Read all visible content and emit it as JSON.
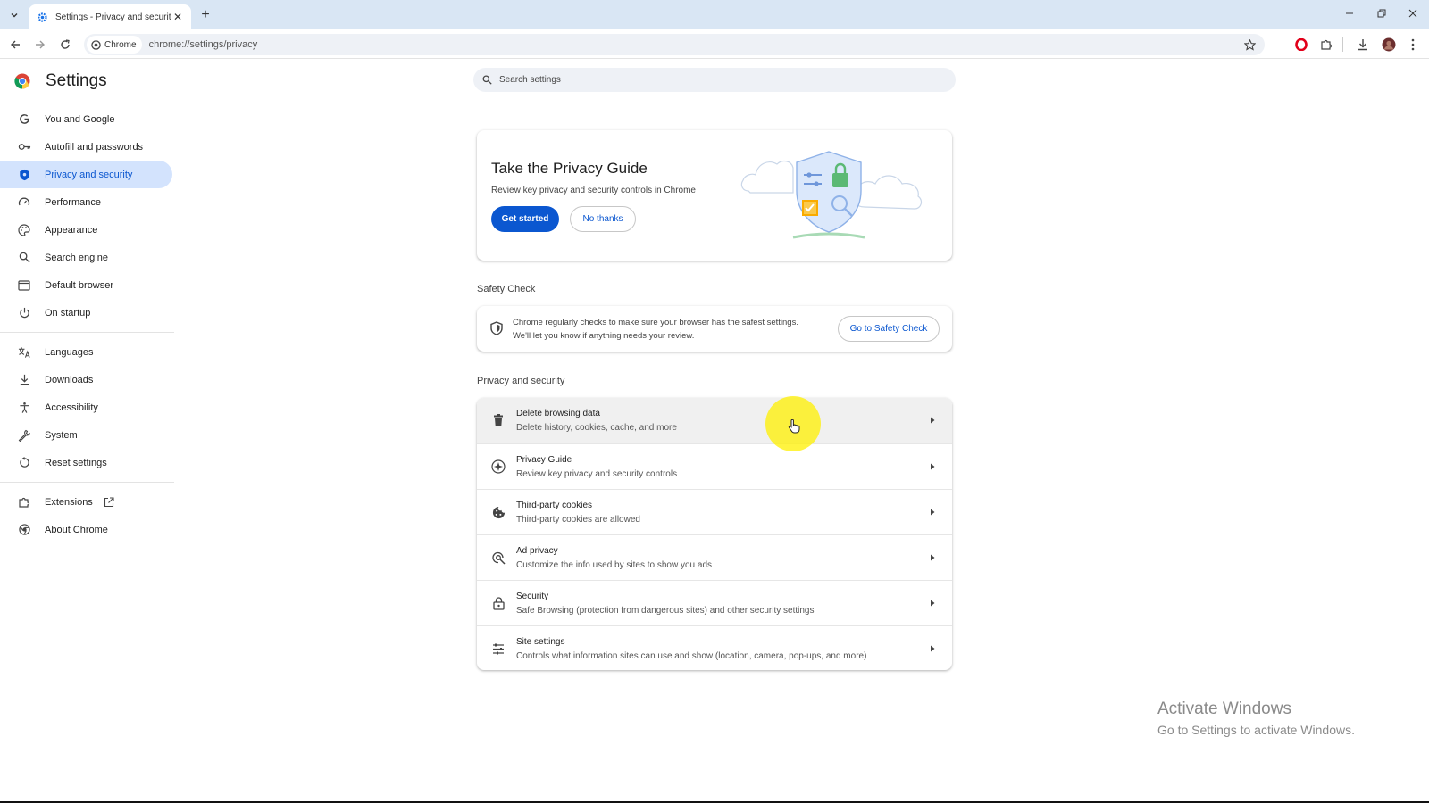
{
  "browser": {
    "tab": {
      "title": "Settings - Privacy and security",
      "close_icon": "close-icon",
      "favicon": "gear-icon"
    },
    "new_tab_icon": "plus-icon",
    "omnibox": {
      "chip_label": "Chrome",
      "url": "chrome://settings/privacy"
    },
    "window_controls": [
      "minimize-icon",
      "restore-icon",
      "close-icon"
    ]
  },
  "sidebar": {
    "title": "Settings",
    "items": [
      {
        "label": "You and Google",
        "icon": "google-g-icon",
        "active": false
      },
      {
        "label": "Autofill and passwords",
        "icon": "key-icon",
        "active": false
      },
      {
        "label": "Privacy and security",
        "icon": "shield-icon",
        "active": true
      },
      {
        "label": "Performance",
        "icon": "speedometer-icon",
        "active": false
      },
      {
        "label": "Appearance",
        "icon": "palette-icon",
        "active": false
      },
      {
        "label": "Search engine",
        "icon": "search-icon",
        "active": false
      },
      {
        "label": "Default browser",
        "icon": "browser-window-icon",
        "active": false
      },
      {
        "label": "On startup",
        "icon": "power-icon",
        "active": false
      },
      {
        "label": "Languages",
        "icon": "translate-icon",
        "active": false
      },
      {
        "label": "Downloads",
        "icon": "download-icon",
        "active": false
      },
      {
        "label": "Accessibility",
        "icon": "accessibility-icon",
        "active": false
      },
      {
        "label": "System",
        "icon": "wrench-icon",
        "active": false
      },
      {
        "label": "Reset settings",
        "icon": "reset-icon",
        "active": false
      },
      {
        "label": "Extensions",
        "icon": "puzzle-icon",
        "active": false
      },
      {
        "label": "About Chrome",
        "icon": "chrome-icon",
        "active": false
      }
    ]
  },
  "search": {
    "placeholder": "Search settings"
  },
  "privacy_guide_card": {
    "title": "Take the Privacy Guide",
    "subtitle": "Review key privacy and security controls in Chrome",
    "primary_button": "Get started",
    "secondary_button": "No thanks"
  },
  "safety_check": {
    "section_title": "Safety Check",
    "line1": "Chrome regularly checks to make sure your browser has the safest settings.",
    "line2": "We'll let you know if anything needs your review.",
    "button": "Go to Safety Check"
  },
  "privacy_section": {
    "title": "Privacy and security",
    "rows": [
      {
        "title": "Delete browsing data",
        "subtitle": "Delete history, cookies, cache, and more",
        "icon": "trash-icon"
      },
      {
        "title": "Privacy Guide",
        "subtitle": "Review key privacy and security controls",
        "icon": "privacy-guide-icon"
      },
      {
        "title": "Third-party cookies",
        "subtitle": "Third-party cookies are allowed",
        "icon": "cookie-icon"
      },
      {
        "title": "Ad privacy",
        "subtitle": "Customize the info used by sites to show you ads",
        "icon": "ad-privacy-icon"
      },
      {
        "title": "Security",
        "subtitle": "Safe Browsing (protection from dangerous sites) and other security settings",
        "icon": "lock-icon"
      },
      {
        "title": "Site settings",
        "subtitle": "Controls what information sites can use and show (location, camera, pop-ups, and more)",
        "icon": "sliders-icon"
      }
    ]
  },
  "watermark": {
    "line1": "Activate Windows",
    "line2": "Go to Settings to activate Windows."
  },
  "colors": {
    "accent": "#0b57d0",
    "active_nav_bg": "#d3e3fd",
    "tabstrip_bg": "#d9e6f4",
    "cursor_highlight": "#fff000"
  }
}
